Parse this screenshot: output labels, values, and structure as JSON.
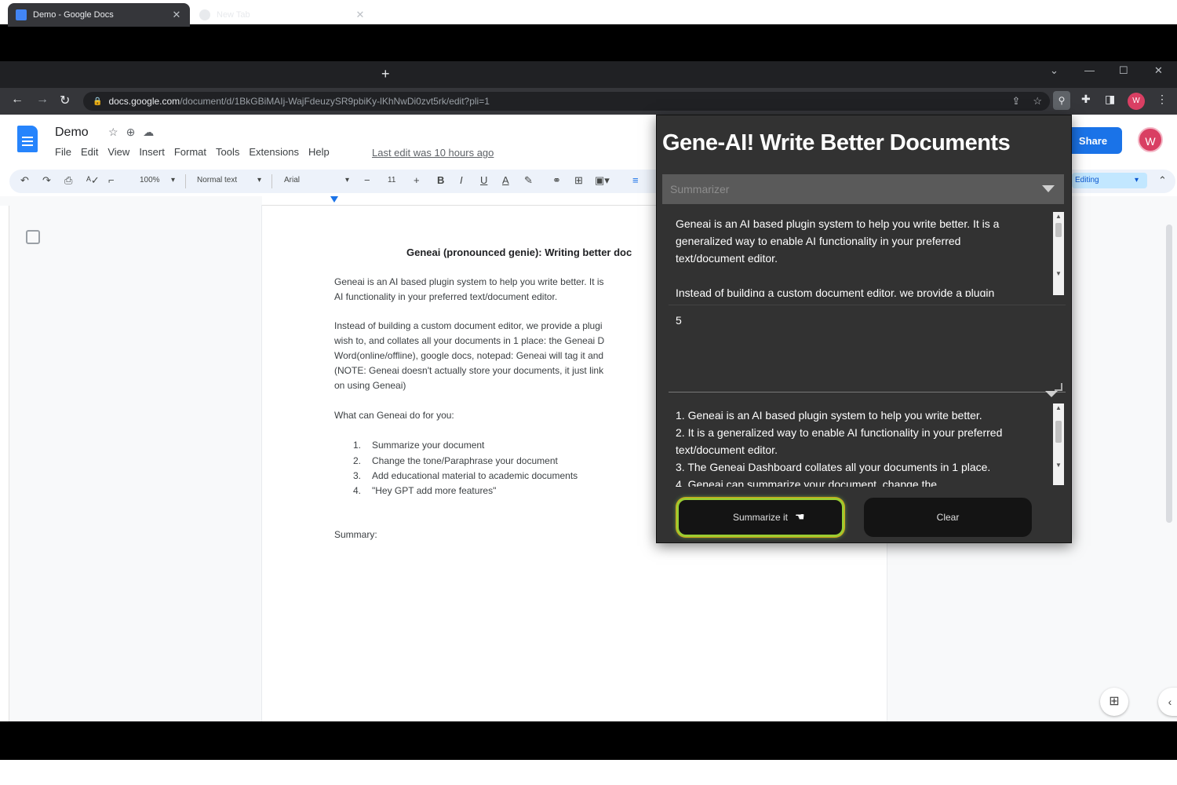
{
  "browser": {
    "tabs": [
      {
        "label": "Demo - Google Docs",
        "active": true
      },
      {
        "label": "New Tab",
        "active": false
      }
    ],
    "url_host": "docs.google.com",
    "url_path": "/document/d/1BkGBiMAIj-WajFdeuzySR9pbiKy-lKhNwDi0zvt5rk/edit?pli=1",
    "profile_initial": "W"
  },
  "docs": {
    "doc_title": "Demo",
    "menu": [
      "File",
      "Edit",
      "View",
      "Insert",
      "Format",
      "Tools",
      "Extensions",
      "Help"
    ],
    "last_edit": "Last edit was 10 hours ago",
    "share_label": "Share",
    "avatar_initial": "W",
    "toolbar": {
      "zoom": "100%",
      "style": "Normal text",
      "font": "Arial",
      "font_size": "11",
      "mode": "Editing"
    },
    "content": {
      "heading": "Geneai (pronounced genie): Writing better doc",
      "p1_line1": "Geneai is an AI based plugin system to help you write better. It is",
      "p1_line2": "AI functionality in your preferred text/document editor.",
      "p2_line1": "Instead of building a custom document editor, we provide a plugi",
      "p2_line2": "wish to, and collates all your documents in 1 place: the Geneai D",
      "p2_line3": "Word(online/offline), google docs, notepad: Geneai will tag it and",
      "p2_line4": "(NOTE: Geneai doesn't actually store your documents, it just link",
      "p2_line5": "on using Geneai)",
      "p3": "What can Geneai do for you:",
      "list": [
        {
          "num": "1.",
          "text": "Summarize your document"
        },
        {
          "num": "2.",
          "text": "Change the tone/Paraphrase your document"
        },
        {
          "num": "3.",
          "text": "Add educational material to academic documents"
        },
        {
          "num": "4.",
          "text": "\"Hey GPT add more features\""
        }
      ],
      "summary_label": "Summary:"
    }
  },
  "popup": {
    "title": "Gene-AI! Write Better Documents",
    "mode_selected": "Summarizer",
    "input_lines": [
      "Geneai is an AI based plugin system to help you write better. It is a",
      "generalized way to enable AI functionality in your preferred",
      "text/document editor.",
      "",
      "Instead of building a custom document editor, we provide a plugin"
    ],
    "count_value": "5",
    "output_lines": [
      "1. Geneai is an AI based plugin system to help you write better.",
      "2. It is a generalized way to enable AI functionality in your preferred",
      "text/document editor.",
      "3. The Geneai Dashboard collates all your documents in 1 place.",
      "4. Geneai can summarize your document, change the"
    ],
    "primary_button": "Summarize it",
    "secondary_button": "Clear"
  },
  "colors": {
    "popup_bg": "#323232",
    "chrome_dark": "#202124",
    "docs_blue": "#1a73e8",
    "primary_glow": "#9acd32"
  }
}
